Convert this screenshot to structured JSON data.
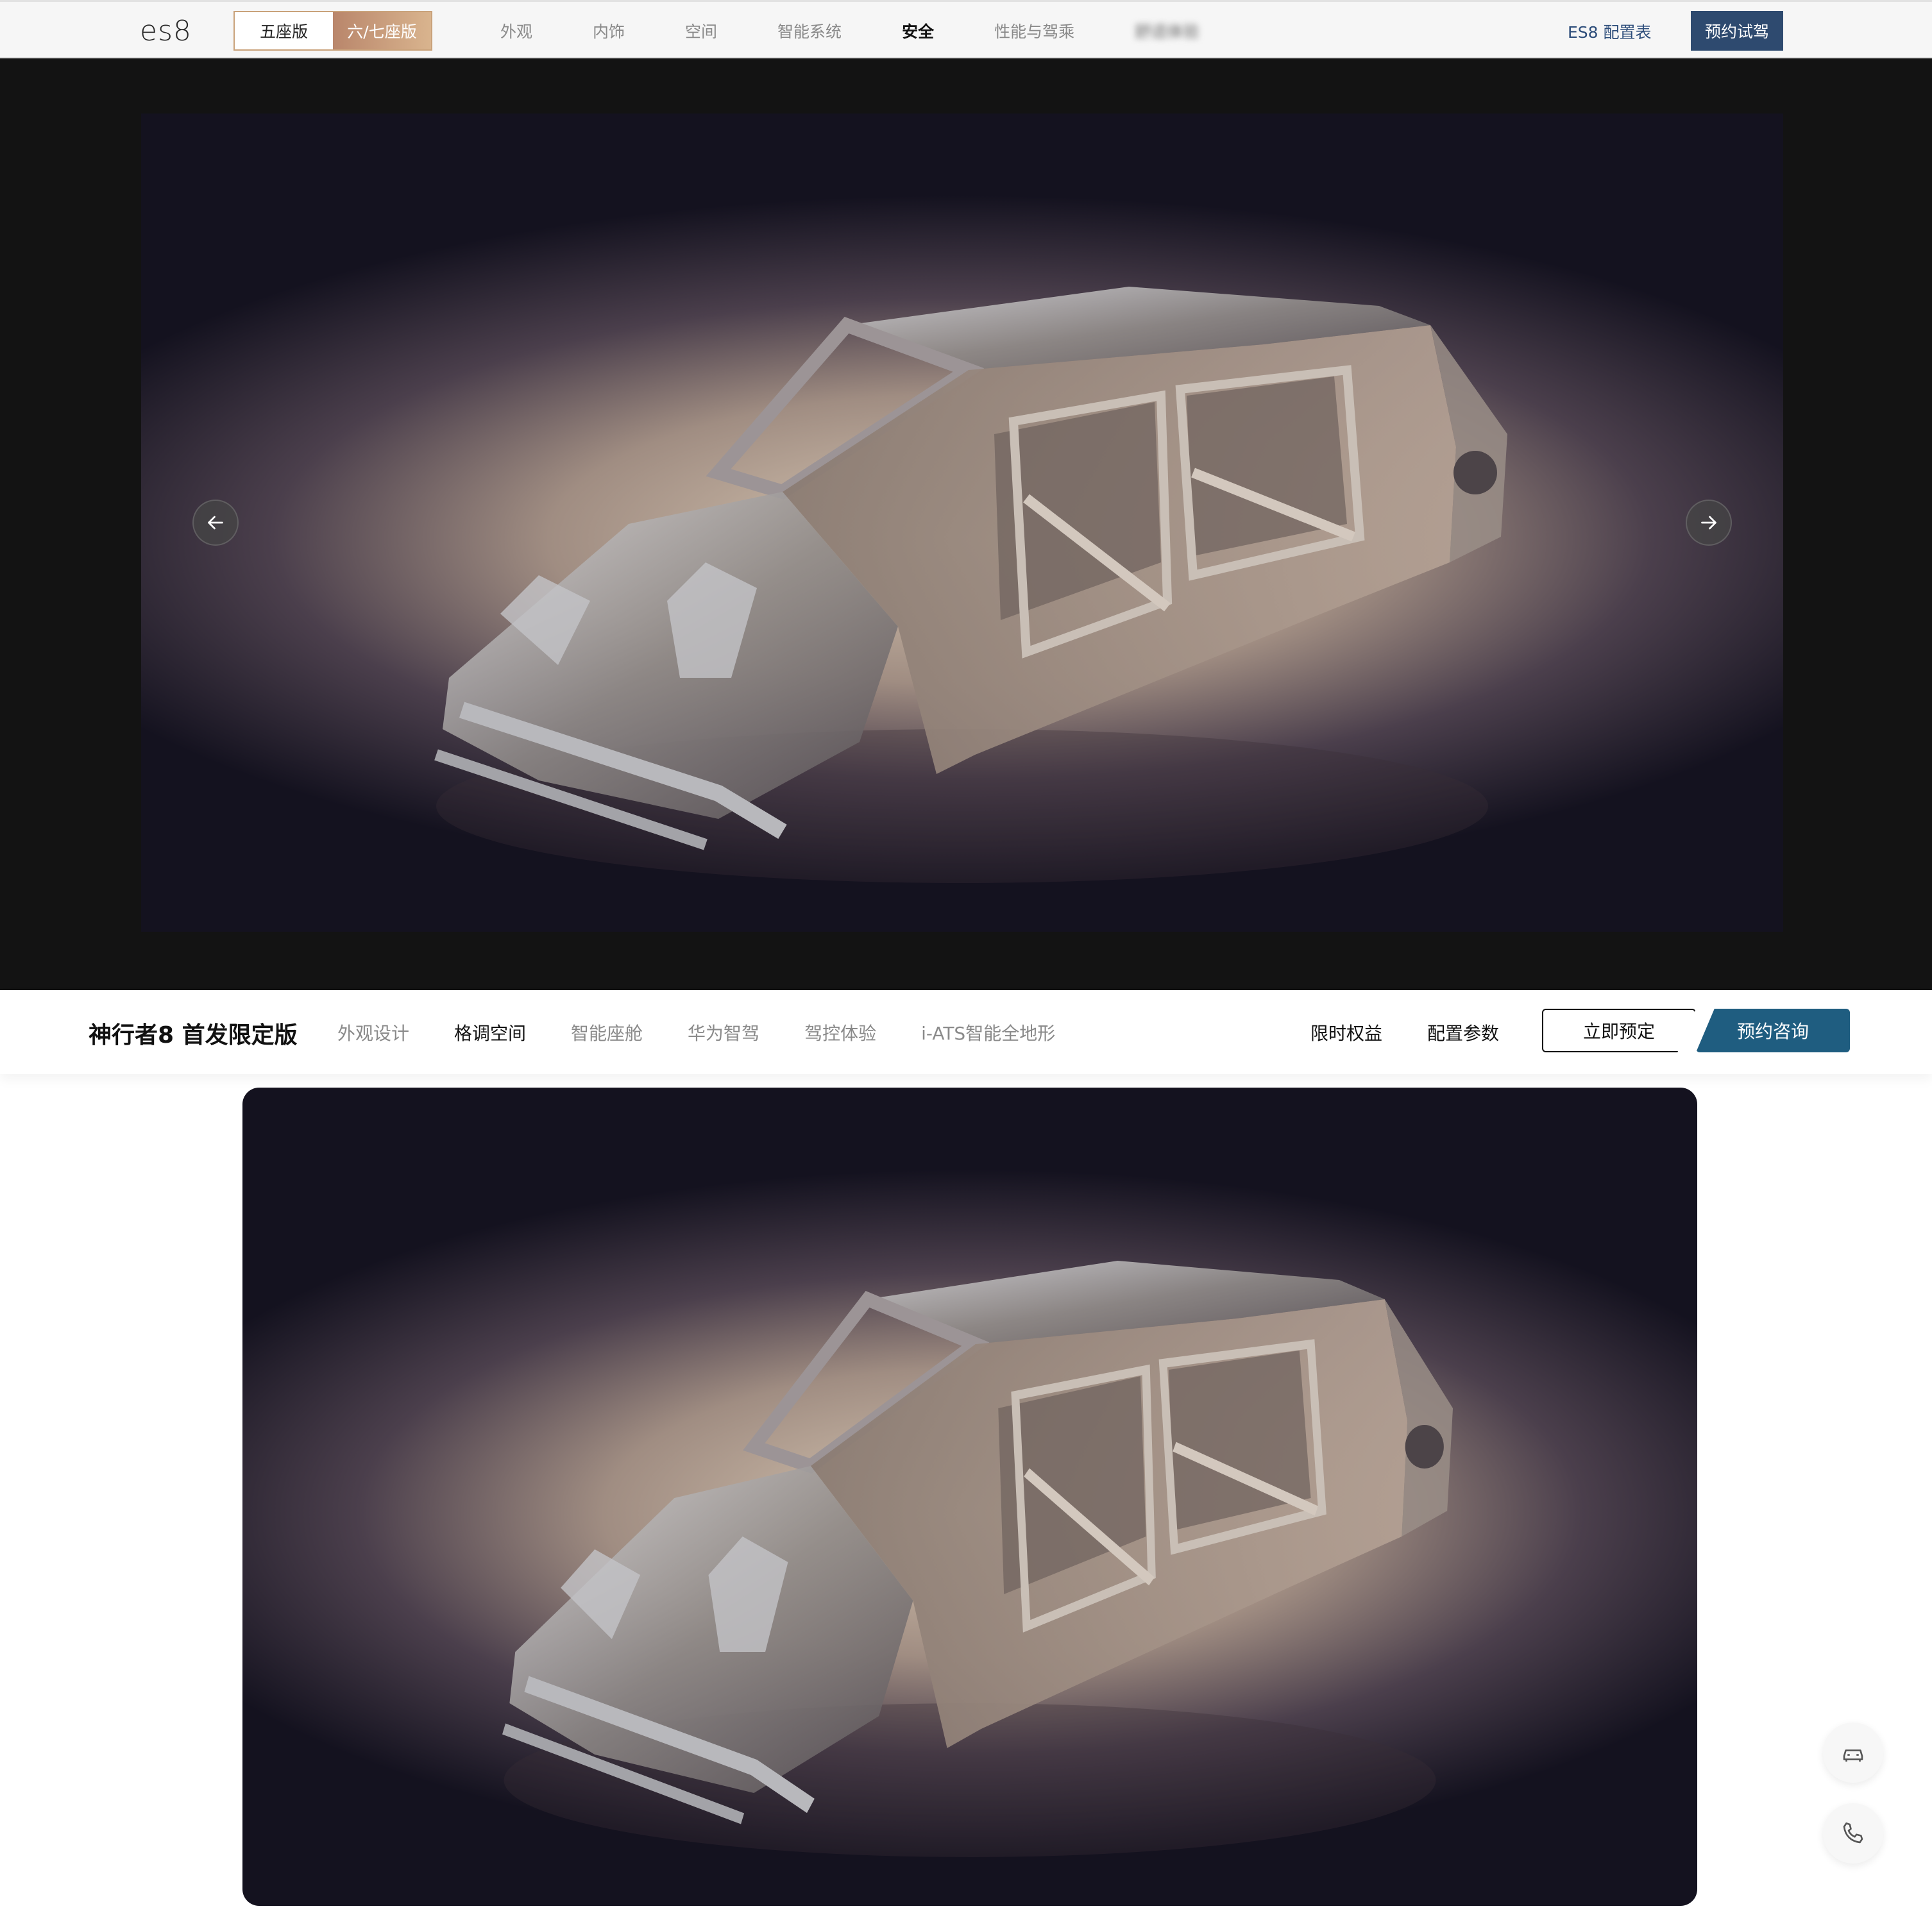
{
  "topnav": {
    "logo": "es8",
    "seat_options": [
      "五座版",
      "六/七座版"
    ],
    "items": [
      "外观",
      "内饰",
      "空间",
      "智能系统",
      "安全",
      "性能与驾乘",
      "舒适体验"
    ],
    "active_item": "安全",
    "config_link": "ES8 配置表",
    "test_drive": "预约试驾"
  },
  "subnav": {
    "title": "神行者8 首发限定版",
    "items": [
      "外观设计",
      "格调空间",
      "智能座舱",
      "华为智驾",
      "驾控体验",
      "i-ATS智能全地形"
    ],
    "active_item": "格调空间",
    "links": [
      "限时权益",
      "配置参数"
    ],
    "reserve": "立即预定",
    "consult": "预约咨询"
  },
  "colors": {
    "accent_blue": "#2e4a6f",
    "consult_teal": "#1f5d80",
    "seat_gold": "#c9a27a"
  },
  "icons": {
    "prev": "arrow-left-icon",
    "next": "arrow-right-icon",
    "float_1": "car-icon",
    "float_2": "phone-icon"
  }
}
